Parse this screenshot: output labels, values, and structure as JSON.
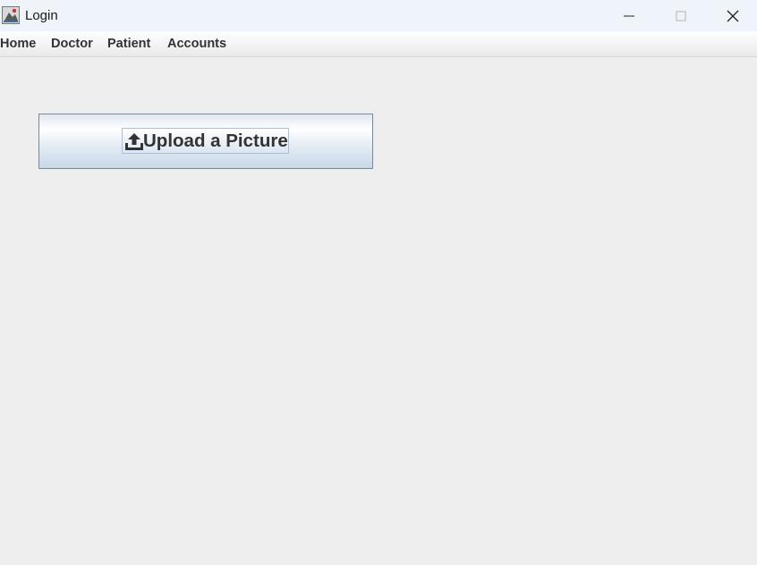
{
  "window": {
    "title": "Login",
    "app_icon": "java-app-icon",
    "controls": {
      "minimize": "minimize-icon",
      "maximize": "maximize-icon",
      "close": "close-icon"
    }
  },
  "menubar": {
    "items": [
      {
        "label": "Home"
      },
      {
        "label": "Doctor"
      },
      {
        "label": "Patient"
      },
      {
        "label": "Accounts"
      }
    ]
  },
  "main": {
    "upload_button": {
      "label": "Upload a Picture",
      "icon": "upload-icon"
    }
  }
}
